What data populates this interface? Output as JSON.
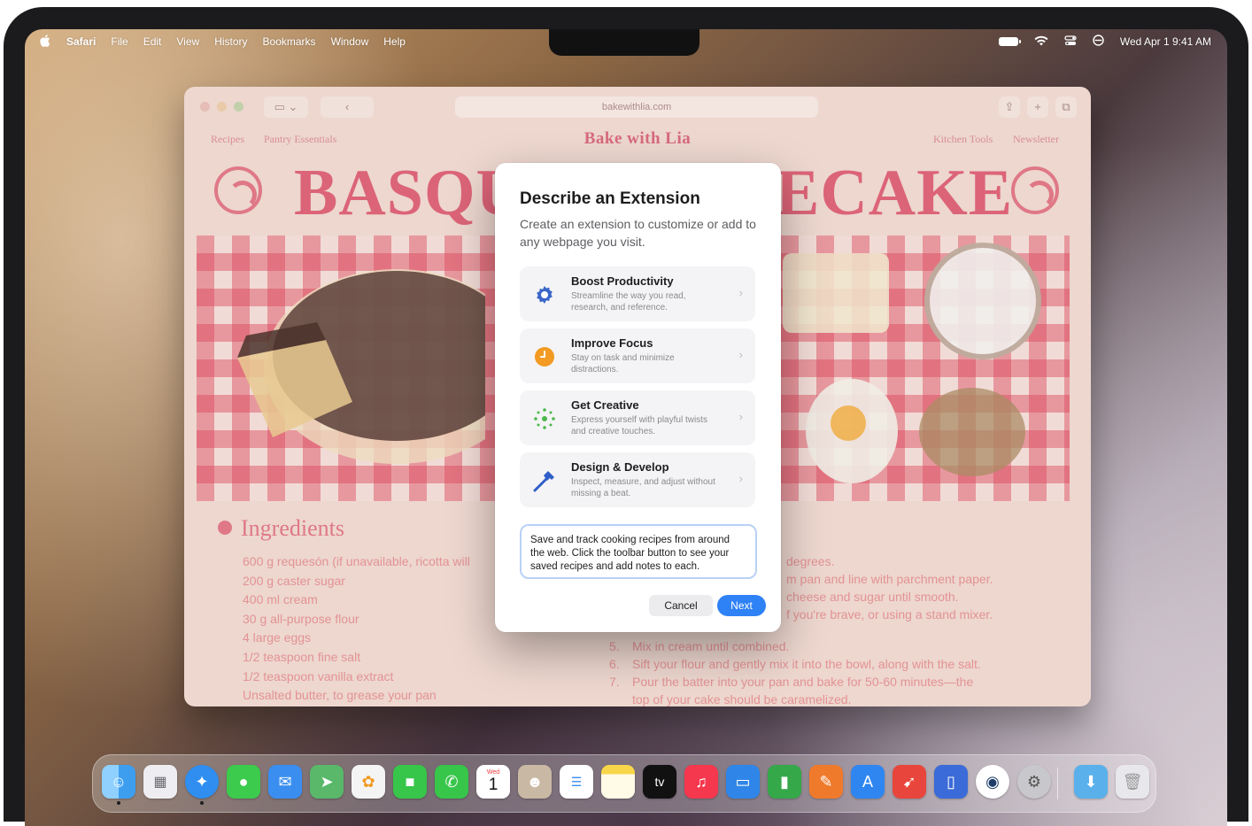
{
  "menubar": {
    "app": "Safari",
    "items": [
      "File",
      "Edit",
      "View",
      "History",
      "Bookmarks",
      "Window",
      "Help"
    ],
    "datetime": "Wed Apr 1  9:41 AM"
  },
  "browser": {
    "url": "bakewithlia.com",
    "nav_left": [
      "Recipes",
      "Pantry Essentials"
    ],
    "brand": "Bake with Lia",
    "nav_right": [
      "Kitchen Tools",
      "Newsletter"
    ],
    "title_left": "BASQU",
    "title_right": "ECAKE",
    "ingredients_title": "Ingredients",
    "ingredients": [
      "600 g requesón (if unavailable, ricotta will",
      "200 g caster sugar",
      "400 ml cream",
      "30 g all-purpose flour",
      "4 large eggs",
      "1/2 teaspoon fine salt",
      "1/2 teaspoon vanilla extract",
      "Unsalted butter, to grease your pan"
    ],
    "steps_fragments": [
      "degrees.",
      "m pan and line with parchment paper.",
      "cheese and sugar until smooth.",
      "f you're brave, or using a stand mixer."
    ],
    "steps": [
      {
        "n": "5.",
        "text": "Mix in cream until combined."
      },
      {
        "n": "6.",
        "text": "Sift your flour and gently mix it into the bowl, along with the salt."
      },
      {
        "n": "7.",
        "text": "Pour the batter into your pan and bake for 50-60 minutes—the"
      },
      {
        "n": "",
        "text": "top of your cake should be caramelized."
      }
    ]
  },
  "dialog": {
    "title": "Describe an Extension",
    "subtitle": "Create an extension to customize or add to any webpage you visit.",
    "options": [
      {
        "title": "Boost Productivity",
        "desc": "Streamline the way you read, research, and reference.",
        "icon": "gear-icon",
        "color": "#3a66c9"
      },
      {
        "title": "Improve Focus",
        "desc": "Stay on task and minimize distractions.",
        "icon": "clock-icon",
        "color": "#f29a22"
      },
      {
        "title": "Get Creative",
        "desc": "Express yourself with playful twists and creative touches.",
        "icon": "sparkle-icon",
        "color": "#4cb84c"
      },
      {
        "title": "Design & Develop",
        "desc": "Inspect, measure, and adjust without missing a beat.",
        "icon": "hammer-icon",
        "color": "#2f5ec8"
      }
    ],
    "description_value": "Save and track cooking recipes from around the web. Click the toolbar button to see your saved recipes and add notes to each.",
    "cancel_label": "Cancel",
    "next_label": "Next"
  },
  "dock": {
    "calendar_month": "Wed",
    "calendar_day": "1",
    "tv_label": "tv",
    "apps": [
      {
        "name": "Finder",
        "color": "#3d9ef0"
      },
      {
        "name": "Launchpad",
        "color": "#e9e9ee"
      },
      {
        "name": "Safari",
        "color": "#2f8ef0"
      },
      {
        "name": "Messages",
        "color": "#3ccb4c"
      },
      {
        "name": "Mail",
        "color": "#3a8ef0"
      },
      {
        "name": "Maps",
        "color": "#59b86a"
      },
      {
        "name": "Photos",
        "color": "#f4f4f4"
      },
      {
        "name": "FaceTime",
        "color": "#37c64a"
      },
      {
        "name": "Phone",
        "color": "#37c64a"
      },
      {
        "name": "Calendar",
        "color": "#ffffff"
      },
      {
        "name": "Contacts",
        "color": "#c9b9a4"
      },
      {
        "name": "Reminders",
        "color": "#ffffff"
      },
      {
        "name": "Notes",
        "color": "#f8d64a"
      },
      {
        "name": "TV",
        "color": "#111111"
      },
      {
        "name": "Music",
        "color": "#f5384e"
      },
      {
        "name": "Keynote",
        "color": "#2f86e8"
      },
      {
        "name": "Numbers",
        "color": "#35a84a"
      },
      {
        "name": "Pages",
        "color": "#f07a2c"
      },
      {
        "name": "App Store",
        "color": "#2f86f0"
      },
      {
        "name": "Rocket",
        "color": "#e8463c"
      },
      {
        "name": "Simulator",
        "color": "#3a6bd8"
      },
      {
        "name": "Browser",
        "color": "#1d3e6a"
      },
      {
        "name": "System Settings",
        "color": "#8e8e93"
      },
      {
        "name": "Downloads",
        "color": "#5ab0ea"
      },
      {
        "name": "Trash",
        "color": "#e6e6ea"
      }
    ]
  }
}
